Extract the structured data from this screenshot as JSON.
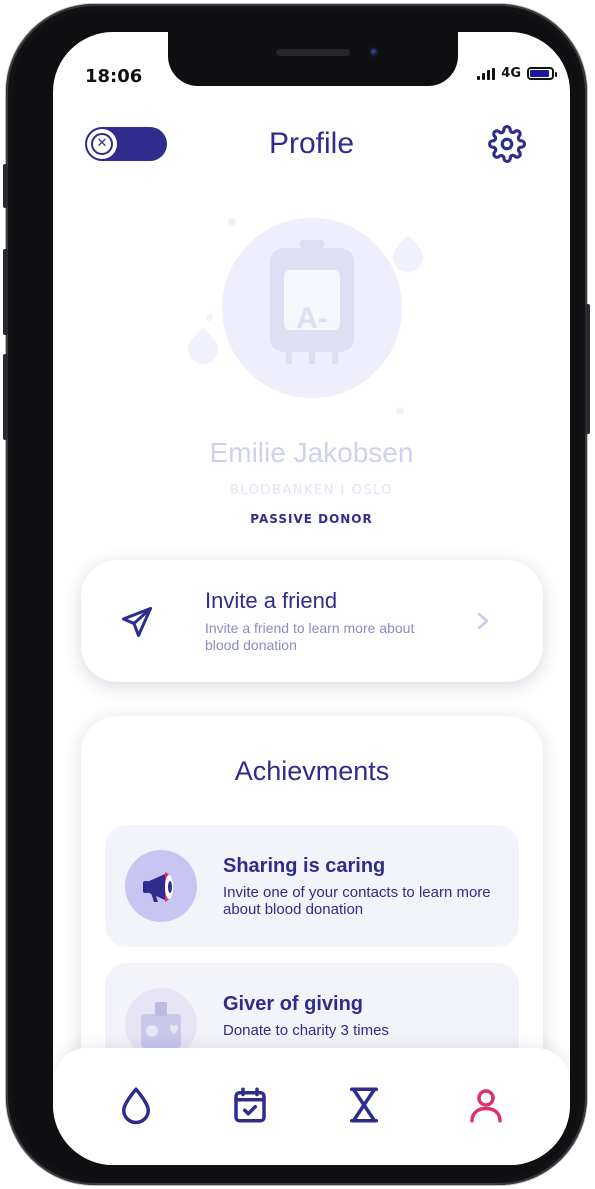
{
  "status_bar": {
    "time": "18:06",
    "network": "4G"
  },
  "header": {
    "title": "Profile",
    "toggle_icon": "close-icon",
    "settings_icon": "gear-icon"
  },
  "profile": {
    "blood_type": "A-",
    "name": "Emilie Jakobsen",
    "organization": "BLODBANKEN I OSLO",
    "donor_status": "PASSIVE DONOR"
  },
  "invite": {
    "title": "Invite a friend",
    "subtitle": "Invite a friend to learn more about blood donation",
    "icon": "send-icon",
    "chevron_icon": "chevron-right-icon"
  },
  "achievements": {
    "title": "Achievments",
    "items": [
      {
        "name": "Sharing is caring",
        "description": "Invite one of your contacts to learn more about blood donation",
        "icon": "megaphone-icon"
      },
      {
        "name": "Giver of giving",
        "description": "Donate to charity 3 times",
        "icon": "charity-box-icon"
      }
    ]
  },
  "bottom_nav": {
    "items": [
      {
        "name": "drop-icon",
        "active": false
      },
      {
        "name": "calendar-check-icon",
        "active": false
      },
      {
        "name": "hourglass-icon",
        "active": false
      },
      {
        "name": "user-icon",
        "active": true
      }
    ]
  },
  "colors": {
    "primary": "#2e2c8c",
    "accent": "#e0306a",
    "muted": "#8b8bc8",
    "avatar_bg": "#eeeefc"
  }
}
